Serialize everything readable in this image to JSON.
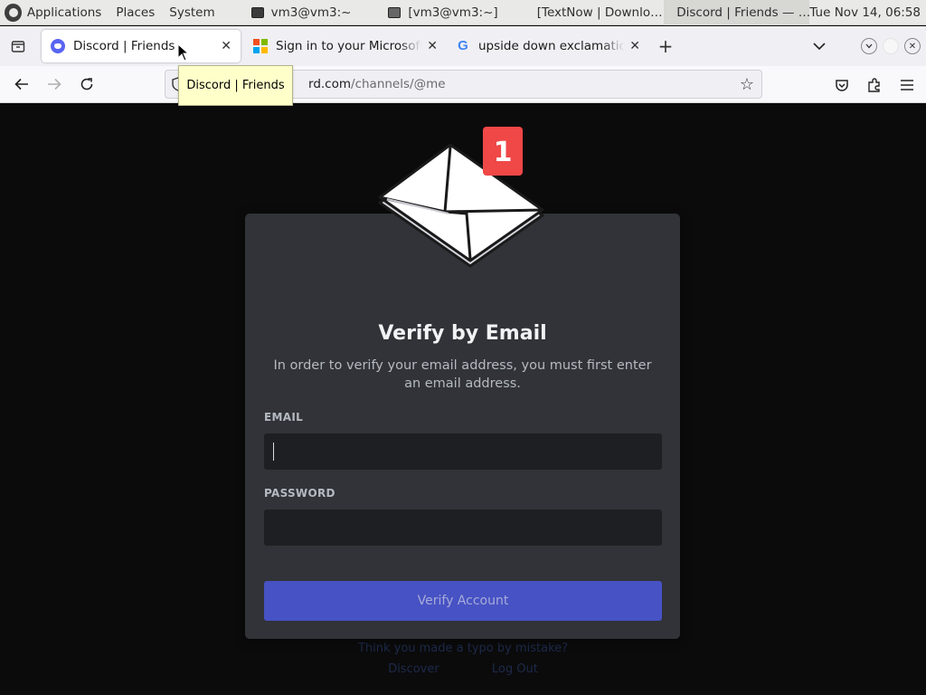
{
  "panel": {
    "menus": [
      "Applications",
      "Places",
      "System"
    ],
    "tasks": [
      {
        "label": "vm3@vm3:~",
        "icon": "terminal-icon"
      },
      {
        "label": "[vm3@vm3:~]",
        "icon": "terminal-icon"
      },
      {
        "label": "[TextNow | Downlo…",
        "icon": "firefox-icon"
      },
      {
        "label": "Discord | Friends — …",
        "icon": "firefox-icon"
      }
    ],
    "clock": "Tue Nov 14, 06:58"
  },
  "browser": {
    "tabs": [
      {
        "title": "Discord | Friends",
        "favicon": "discord-icon",
        "selected": true
      },
      {
        "title": "Sign in to your Microsoft acc",
        "favicon": "microsoft-icon",
        "selected": false
      },
      {
        "title": "upside down exclamation po",
        "favicon": "google-icon",
        "selected": false
      }
    ],
    "tooltip": "Discord | Friends",
    "url": {
      "host": "rd.com",
      "path": "/channels/@me"
    }
  },
  "dialog": {
    "badge": "1",
    "title": "Verify by Email",
    "subtitle": "In order to verify your email address, you must first enter an email address.",
    "email_label": "EMAIL",
    "email_value": "",
    "password_label": "PASSWORD",
    "password_value": "",
    "button_label": "Verify Account"
  },
  "background": {
    "line1": "Think you made a typo by mistake?",
    "link1": "Discover",
    "link2": "Log Out"
  },
  "colors": {
    "card": "#313338",
    "input": "#1e1f22",
    "button": "#4752c4",
    "badge": "#f04747"
  }
}
